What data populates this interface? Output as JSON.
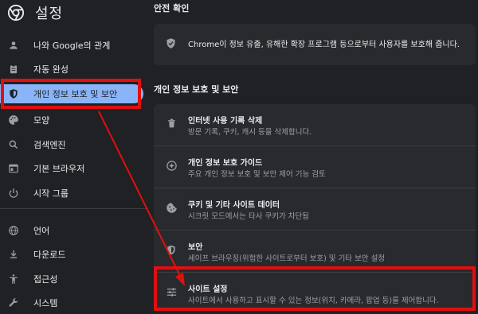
{
  "app": {
    "title": "설정"
  },
  "sidebar": {
    "items": [
      {
        "label": "나와 Google의 관계",
        "icon": "person-icon"
      },
      {
        "label": "자동 완성",
        "icon": "clipboard-icon"
      },
      {
        "label": "개인 정보 보호 및 보안",
        "icon": "shield-icon",
        "active": true
      },
      {
        "label": "모양",
        "icon": "palette-icon"
      },
      {
        "label": "검색엔진",
        "icon": "search-icon"
      },
      {
        "label": "기본 브라우저",
        "icon": "browser-icon"
      },
      {
        "label": "시작 그룹",
        "icon": "power-icon"
      },
      {
        "label": "언어",
        "icon": "globe-icon"
      },
      {
        "label": "다운로드",
        "icon": "download-icon"
      },
      {
        "label": "접근성",
        "icon": "accessibility-icon"
      },
      {
        "label": "시스템",
        "icon": "wrench-icon"
      }
    ]
  },
  "safety_check": {
    "title": "안전 확인",
    "text": "Chrome이 정보 유출, 유해한 확장 프로그램 등으로부터 사용자를 보호해 줍니다."
  },
  "privacy": {
    "title": "개인 정보 보호 및 보안",
    "rows": [
      {
        "title": "인터넷 사용 기록 삭제",
        "desc": "방문 기록, 쿠키, 캐시 등을 삭제합니다.",
        "icon": "trash-icon"
      },
      {
        "title": "개인 정보 보호 가이드",
        "desc": "주요 개인 정보 보호 및 보안 제어 기능 검토",
        "icon": "compass-icon"
      },
      {
        "title": "쿠키 및 기타 사이트 데이터",
        "desc": "시크릿 모드에서는 타사 쿠키가 차단됨",
        "icon": "cookie-icon"
      },
      {
        "title": "보안",
        "desc": "세이프 브라우징(위험한 사이트로부터 보호) 및 기타 보안 설정",
        "icon": "security-shield-icon"
      },
      {
        "title": "사이트 설정",
        "desc": "사이트에서 사용하고 표시할 수 있는 정보(위치, 카메라, 팝업 등)를 제어합니다.",
        "icon": "sliders-icon"
      }
    ]
  },
  "colors": {
    "accent": "#8ab4f8",
    "highlight": "#e01010",
    "background": "#202124",
    "card": "#292a2d"
  }
}
